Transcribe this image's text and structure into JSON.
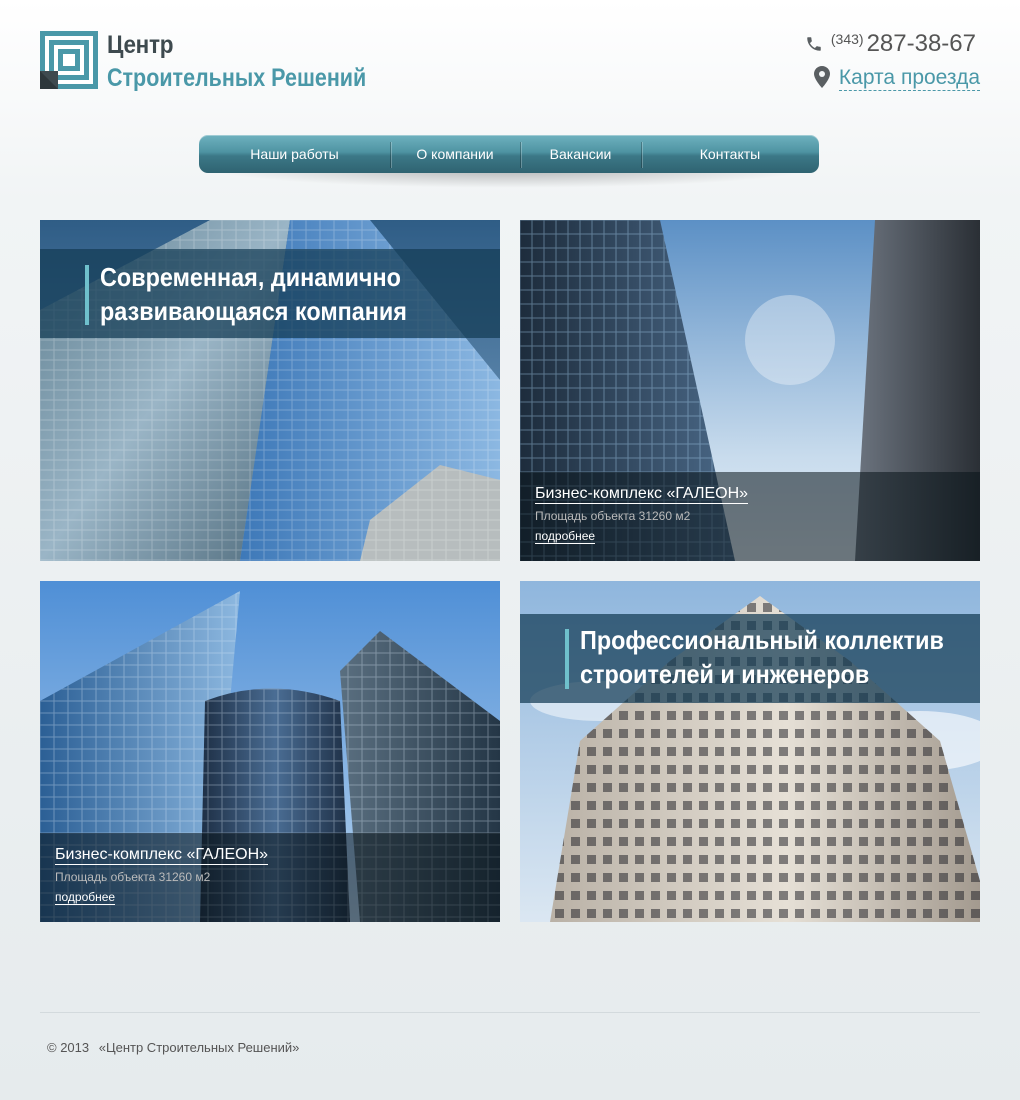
{
  "header": {
    "logo_line1": "Центр",
    "logo_line2": "Строительных Решений",
    "phone_code": "(343)",
    "phone_number": "287-38-67",
    "map_link": "Карта проезда"
  },
  "nav": {
    "items": [
      {
        "label": "Наши работы"
      },
      {
        "label": "О компании"
      },
      {
        "label": "Вакансии"
      },
      {
        "label": "Контакты"
      }
    ]
  },
  "tiles": [
    {
      "tagline_line1": "Современная, динамично",
      "tagline_line2": "развивающаяся компания"
    },
    {
      "title": "Бизнес-комплекс «ГАЛЕОН»",
      "subtitle": "Площадь объекта 31260 м2",
      "more": "подробнее"
    },
    {
      "title": "Бизнес-комплекс «ГАЛЕОН»",
      "subtitle": "Площадь объекта 31260 м2",
      "more": "подробнее"
    },
    {
      "tagline_line1": "Профессиональный коллектив",
      "tagline_line2": "строителей и инженеров"
    }
  ],
  "footer": {
    "copyright": "© 2013",
    "company": "«Центр Строительных Решений»"
  },
  "colors": {
    "accent": "#4a98a8",
    "nav": "#4e93a2"
  }
}
